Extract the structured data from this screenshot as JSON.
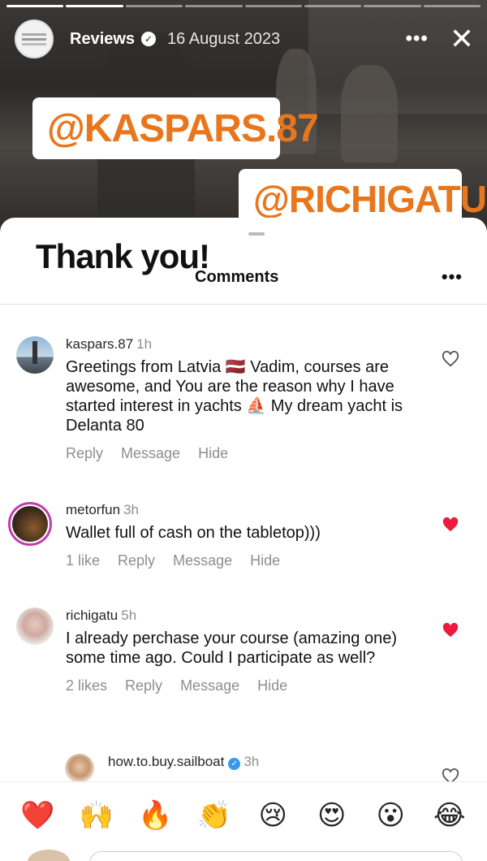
{
  "story": {
    "username": "Reviews",
    "date": "16 August 2023",
    "more_label": "•••",
    "close_label": "✕",
    "verified_icon": "✓",
    "mentions": [
      "@KASPARS.87",
      "@RICHIGATU"
    ]
  },
  "sheet": {
    "overlay_text": "Thank you!",
    "title": "Comments",
    "more_label": "•••"
  },
  "comments": [
    {
      "user": "kaspars.87",
      "time": "1h",
      "text": "Greetings from Latvia 🇱🇻 Vadim, courses are awesome, and You are the reason why I have started interest in yachts ⛵ My dream yacht is Delanta 80",
      "likes": "",
      "liked": false,
      "actions": [
        "Reply",
        "Message",
        "Hide"
      ]
    },
    {
      "user": "metorfun",
      "time": "3h",
      "text": "Wallet full of cash on the tabletop)))",
      "likes": "1 like",
      "liked": true,
      "actions": [
        "Reply",
        "Message",
        "Hide"
      ]
    },
    {
      "user": "richigatu",
      "time": "5h",
      "text": "I already perchase your course (amazing one) some time ago. Could I participate as well?",
      "likes": "2 likes",
      "liked": true,
      "actions": [
        "Reply",
        "Message",
        "Hide"
      ]
    },
    {
      "user": "how.to.buy.sailboat",
      "time": "3h",
      "verified": true
    }
  ],
  "emojis": [
    "❤️",
    "🙌",
    "🔥",
    "👏",
    "😢",
    "😍",
    "😮",
    "😂"
  ],
  "colors": {
    "accent_orange": "#e8761c",
    "like_red": "#ed1c3f",
    "story_ring": "#c23db0"
  }
}
